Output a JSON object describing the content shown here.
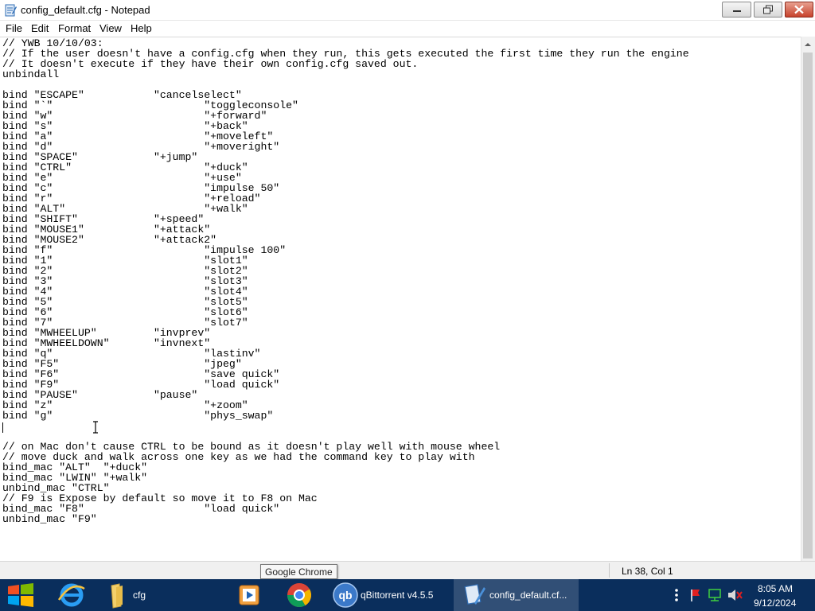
{
  "window": {
    "title": "config_default.cfg - Notepad"
  },
  "menu": [
    "File",
    "Edit",
    "Format",
    "View",
    "Help"
  ],
  "editor": {
    "content": "// YWB 10/10/03:\n// If the user doesn't have a config.cfg when they run, this gets executed the first time they run the engine\n// It doesn't execute if they have their own config.cfg saved out.\nunbindall\n\nbind \"ESCAPE\"\t\t\"cancelselect\"\nbind \"`\"\t\t\t\"toggleconsole\"\nbind \"w\"\t\t\t\"+forward\"\nbind \"s\"\t\t\t\"+back\"\nbind \"a\"\t\t\t\"+moveleft\"\nbind \"d\"\t\t\t\"+moveright\"\nbind \"SPACE\"\t\t\"+jump\"\nbind \"CTRL\"\t\t\t\"+duck\"\nbind \"e\"\t\t\t\"+use\"\nbind \"c\"\t\t\t\"impulse 50\"\nbind \"r\"\t\t\t\"+reload\"\nbind \"ALT\"\t\t\t\"+walk\"\nbind \"SHIFT\"\t\t\"+speed\"\nbind \"MOUSE1\"\t\t\"+attack\"\nbind \"MOUSE2\"\t\t\"+attack2\"\nbind \"f\"\t\t\t\"impulse 100\"\nbind \"1\"\t\t\t\"slot1\"\nbind \"2\"\t\t\t\"slot2\"\nbind \"3\"\t\t\t\"slot3\"\nbind \"4\"\t\t\t\"slot4\"\nbind \"5\"\t\t\t\"slot5\"\nbind \"6\"\t\t\t\"slot6\"\nbind \"7\"\t\t\t\"slot7\"\nbind \"MWHEELUP\"\t\t\"invprev\"\nbind \"MWHEELDOWN\"\t\"invnext\"\nbind \"q\"\t\t\t\"lastinv\"\nbind \"F5\"\t\t\t\"jpeg\"\nbind \"F6\"\t\t\t\"save quick\"\nbind \"F9\"\t\t\t\"load quick\"\nbind \"PAUSE\"\t\t\"pause\"\nbind \"z\"\t\t\t\"+zoom\"\nbind \"g\"\t\t\t\"phys_swap\"\n\n\n// on Mac don't cause CTRL to be bound as it doesn't play well with mouse wheel\n// move duck and walk across one key as we had the command key to play with\nbind_mac \"ALT\"\t\"+duck\"\nbind_mac \"LWIN\"\t\"+walk\"\nunbind_mac \"CTRL\"\n// F9 is Expose by default so move it to F8 on Mac\nbind_mac \"F8\"\t\t\t\"load quick\"\nunbind_mac \"F9\""
  },
  "status": {
    "position": "Ln 38, Col 1"
  },
  "tooltip": "Google Chrome",
  "taskbar": {
    "items": [
      {
        "label": "cfg"
      },
      {
        "label": "qBittorrent v4.5.5"
      },
      {
        "label": "config_default.cf..."
      }
    ],
    "time": "8:05 AM",
    "date": "9/12/2024"
  }
}
